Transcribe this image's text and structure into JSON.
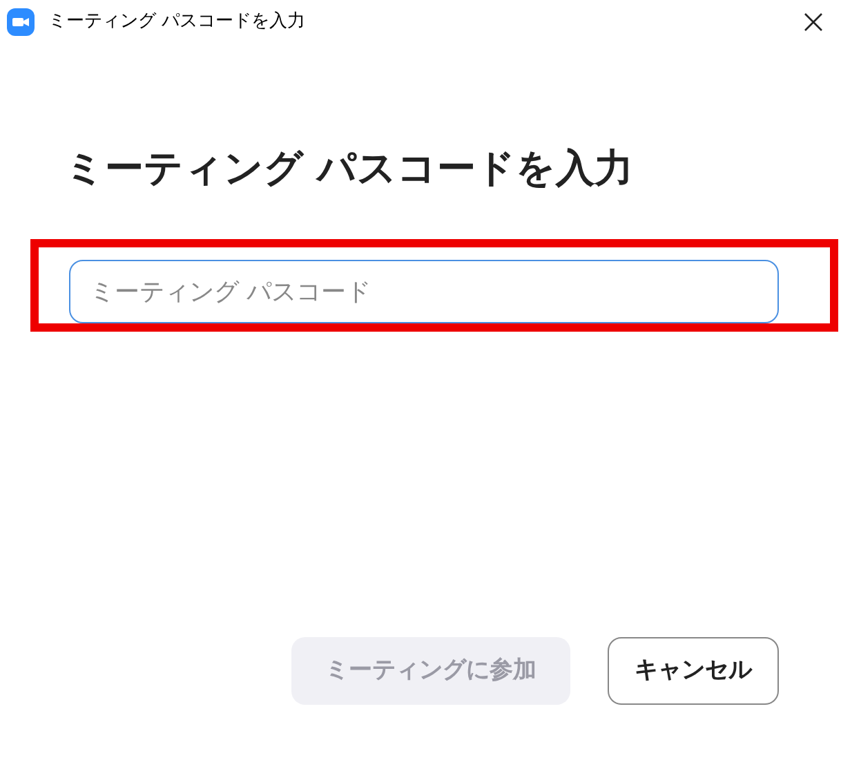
{
  "window": {
    "title": "ミーティング パスコードを入力"
  },
  "heading": "ミーティング パスコードを入力",
  "passcode_field": {
    "placeholder": "ミーティング パスコード",
    "highlighted": true
  },
  "buttons": [
    {
      "label": "ミーティングに参加",
      "kind": "primary",
      "disabled": true
    },
    {
      "label": "キャンセル",
      "kind": "secondary",
      "disabled": false
    }
  ]
}
